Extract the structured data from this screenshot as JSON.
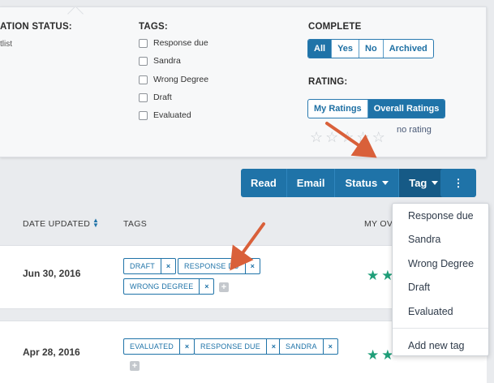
{
  "filters": {
    "application_status": {
      "title": "ATION STATUS:",
      "partial_item": "tlist"
    },
    "tags": {
      "title": "TAGS:",
      "options": [
        "Response due",
        "Sandra",
        "Wrong Degree",
        "Draft",
        "Evaluated"
      ]
    },
    "complete": {
      "title": "COMPLETE",
      "options": [
        "All",
        "Yes",
        "No",
        "Archived"
      ],
      "selected": "All"
    },
    "rating": {
      "title": "RATING:",
      "options": [
        "My Ratings",
        "Overall Ratings"
      ],
      "selected": "Overall Ratings",
      "empty_label": "no rating",
      "max_stars": 5
    }
  },
  "toolbar": {
    "read_label": "Read",
    "email_label": "Email",
    "status_label": "Status",
    "tag_label": "Tag",
    "more_label": "⋮"
  },
  "table": {
    "headers": {
      "date_updated": "DATE UPDATED",
      "tags": "TAGS",
      "my_rating": "MY OVE"
    },
    "rows": [
      {
        "date": "Jun 30, 2016",
        "tags": [
          "DRAFT",
          "RESPONSE DU",
          "WRONG DEGREE"
        ]
      },
      {
        "date": "Apr 28, 2016",
        "tags": [
          "EVALUATED",
          "RESPONSE DUE",
          "SANDRA"
        ]
      }
    ]
  },
  "tag_dropdown": {
    "items": [
      "Response due",
      "Sandra",
      "Wrong Degree",
      "Draft",
      "Evaluated"
    ],
    "add_label": "Add new tag"
  },
  "icons": {
    "remove_tag": "×",
    "add_tag": "+",
    "star_outline": "☆",
    "star_filled": "★",
    "sort": "▲▼"
  },
  "colors": {
    "primary": "#1f73a8",
    "primary_dark": "#165a86",
    "star_green": "#1e9e78",
    "annotation_arrow": "#d9603a"
  }
}
